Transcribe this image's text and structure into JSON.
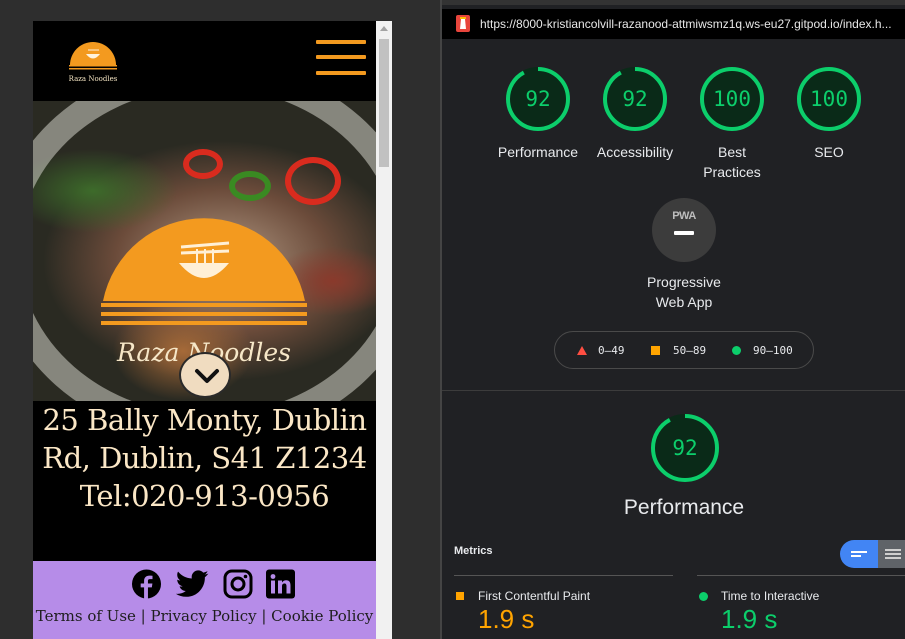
{
  "site": {
    "logo_text": "Raza Noodles",
    "hero_logo_text": "Raza Noodles",
    "address_lines": [
      "25 Bally Monty, Dublin",
      "Rd, Dublin, S41 Z1234",
      "Tel:020-913-0956"
    ],
    "social_icons": [
      "facebook-icon",
      "twitter-icon",
      "instagram-icon",
      "linkedin-icon"
    ],
    "footer_links": "Terms of Use | Privacy Policy | Cookie Policy",
    "colors": {
      "accent": "#f39a1f",
      "footer_bg": "#b68ce8",
      "address_text": "#fbe7c6"
    }
  },
  "lighthouse": {
    "url": "https://8000-kristiancolvill-razanood-attmiwsmz1q.ws-eu27.gitpod.io/index.h...",
    "scores": [
      {
        "label": "Performance",
        "value": 92
      },
      {
        "label": "Accessibility",
        "value": 92
      },
      {
        "label_lines": [
          "Best",
          "Practices"
        ],
        "value": 100
      },
      {
        "label": "SEO",
        "value": 100
      }
    ],
    "pwa": {
      "badge": "PWA",
      "label_lines": [
        "Progressive",
        "Web App"
      ]
    },
    "legend": [
      {
        "shape": "triangle",
        "range": "0–49",
        "color": "#ff4e42"
      },
      {
        "shape": "square",
        "range": "50–89",
        "color": "#ffa400"
      },
      {
        "shape": "circle",
        "range": "90–100",
        "color": "#0cce6b"
      }
    ],
    "performance": {
      "score": 92,
      "title": "Performance"
    },
    "metrics_label": "Metrics",
    "metrics": [
      {
        "name": "First Contentful Paint",
        "value": "1.9 s",
        "status": "average",
        "color": "#ffa400"
      },
      {
        "name": "Time to Interactive",
        "value": "1.9 s",
        "status": "good",
        "color": "#0cce6b"
      }
    ]
  }
}
